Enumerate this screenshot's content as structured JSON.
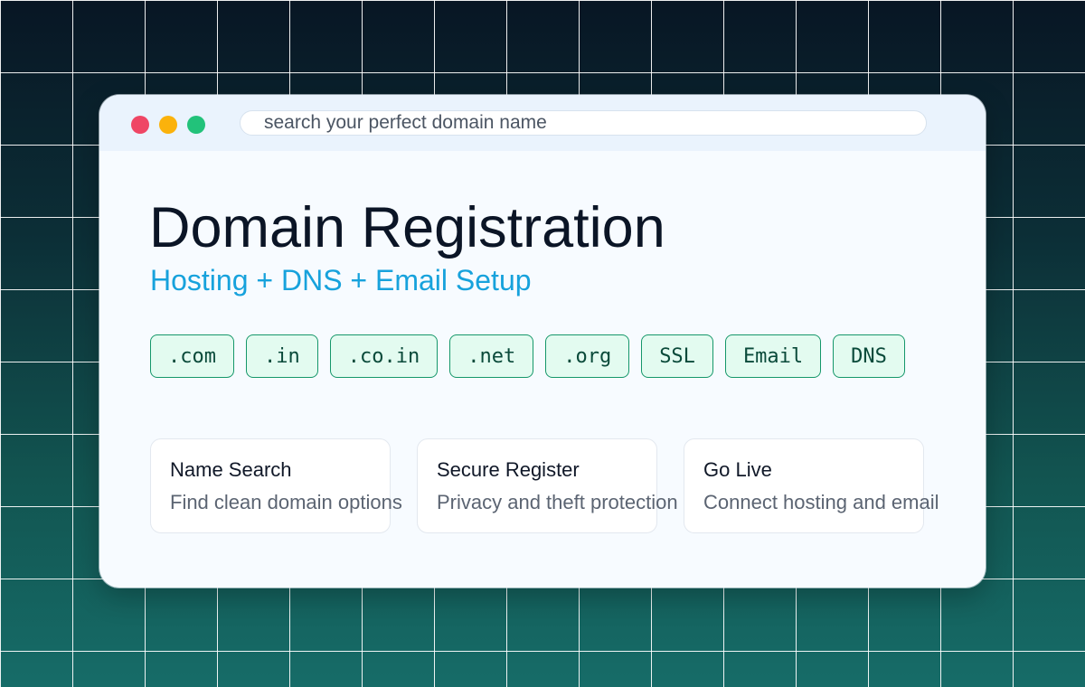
{
  "colors": {
    "window_close": "#ef4665",
    "window_minimize": "#fbb20b",
    "window_maximize": "#22c27a",
    "accent": "#17a2dc",
    "tag_border": "#15976a",
    "tag_background": "#e3fbf0"
  },
  "window": {
    "controls": [
      {
        "icon": "close-dot",
        "color": "#ef4665"
      },
      {
        "icon": "minimize-dot",
        "color": "#fbb20b"
      },
      {
        "icon": "maximize-dot",
        "color": "#22c27a"
      }
    ],
    "search": {
      "placeholder": "search your perfect domain name",
      "value": ""
    }
  },
  "main": {
    "title": "Domain Registration",
    "subtitle": "Hosting + DNS + Email Setup",
    "tags": [
      ".com",
      ".in",
      ".co.in",
      ".net",
      ".org",
      "SSL",
      "Email",
      "DNS"
    ],
    "cards": [
      {
        "title": "Name Search",
        "description": "Find clean domain options"
      },
      {
        "title": "Secure Register",
        "description": "Privacy and theft protection"
      },
      {
        "title": "Go Live",
        "description": "Connect hosting and email"
      }
    ]
  }
}
